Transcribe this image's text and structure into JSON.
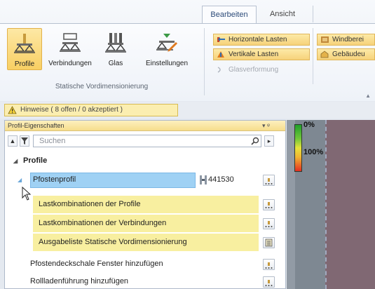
{
  "ribbon": {
    "tabs": [
      {
        "label": "Bearbeiten",
        "active": true
      },
      {
        "label": "Ansicht",
        "active": false
      }
    ],
    "group_label": "Statische Vordimensionierung",
    "buttons": [
      {
        "label": "Profile",
        "icon": "profile-icon",
        "selected": true
      },
      {
        "label": "Verbindungen",
        "icon": "connections-icon",
        "selected": false
      },
      {
        "label": "Glas",
        "icon": "glass-icon",
        "selected": false
      },
      {
        "label": "Einstellungen",
        "icon": "settings-icon",
        "selected": false
      }
    ],
    "small_buttons": [
      {
        "label": "Horizontale Lasten",
        "icon": "horizontal-loads-icon"
      },
      {
        "label": "Vertikale Lasten",
        "icon": "vertical-loads-icon"
      },
      {
        "label": "Glasverformung",
        "icon": "glass-deformation-icon",
        "disabled": true
      },
      {
        "label": "Windberei",
        "icon": "wind-zone-icon"
      },
      {
        "label": "Gebäudeu",
        "icon": "building-icon"
      }
    ]
  },
  "notice": {
    "label": "Hinweise ( 8 offen / 0 akzeptiert )",
    "icon": "warning-icon"
  },
  "panel": {
    "title": "Profil-Eigenschaften",
    "pin_glyph": "▾ ᵠ",
    "search": {
      "placeholder": "Suchen",
      "value": ""
    },
    "section": "Profile",
    "rows": [
      {
        "label": "Pfostenprofil",
        "value": "441530",
        "selected": true
      },
      {
        "label": "Lastkombinationen der Profile"
      },
      {
        "label": "Lastkombinationen der Verbindungen"
      },
      {
        "label": "Ausgabeliste Statische Vordimensionierung"
      },
      {
        "label": "Pfostendeckschale Fenster hinzufügen"
      },
      {
        "label": "Rollladenführung hinzufügen"
      }
    ]
  },
  "view": {
    "scale_top": "0%",
    "scale_bottom": "100%"
  },
  "colors": {
    "accent": "#f8cf63",
    "selection": "#9fd1f4",
    "highlight": "#f8efa0"
  }
}
